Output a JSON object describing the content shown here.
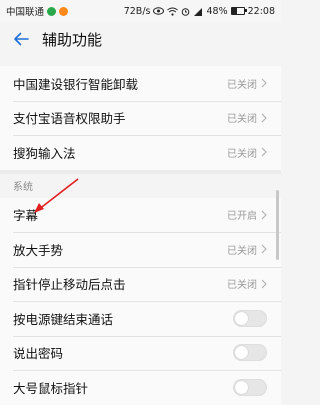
{
  "status_bar": {
    "carrier": "中国联通",
    "speed": "72B/s",
    "battery": "48%",
    "time": "22:08"
  },
  "header": {
    "title": "辅助功能"
  },
  "apps_group": [
    {
      "label": "中国建设银行智能卸载",
      "status": "已关闭"
    },
    {
      "label": "支付宝语音权限助手",
      "status": "已关闭"
    },
    {
      "label": "搜狗输入法",
      "status": "已关闭"
    }
  ],
  "system_section": {
    "header": "系统",
    "rows": [
      {
        "label": "字幕",
        "status": "已开启",
        "kind": "link"
      },
      {
        "label": "放大手势",
        "status": "已关闭",
        "kind": "link"
      },
      {
        "label": "指针停止移动后点击",
        "status": "已关闭",
        "kind": "link"
      },
      {
        "label": "按电源键结束通话",
        "kind": "toggle",
        "on": false
      },
      {
        "label": "说出密码",
        "kind": "toggle",
        "on": false
      },
      {
        "label": "大号鼠标指针",
        "kind": "toggle",
        "on": false
      }
    ]
  },
  "colors": {
    "accent": "#1e6fd9",
    "annotation_arrow": "#e02020"
  },
  "icons": {
    "back": "arrow-left-icon",
    "chevron": "chevron-right-icon",
    "status": [
      "signal-icon",
      "wifi-icon",
      "eye-icon",
      "alarm-icon",
      "battery-icon"
    ]
  }
}
